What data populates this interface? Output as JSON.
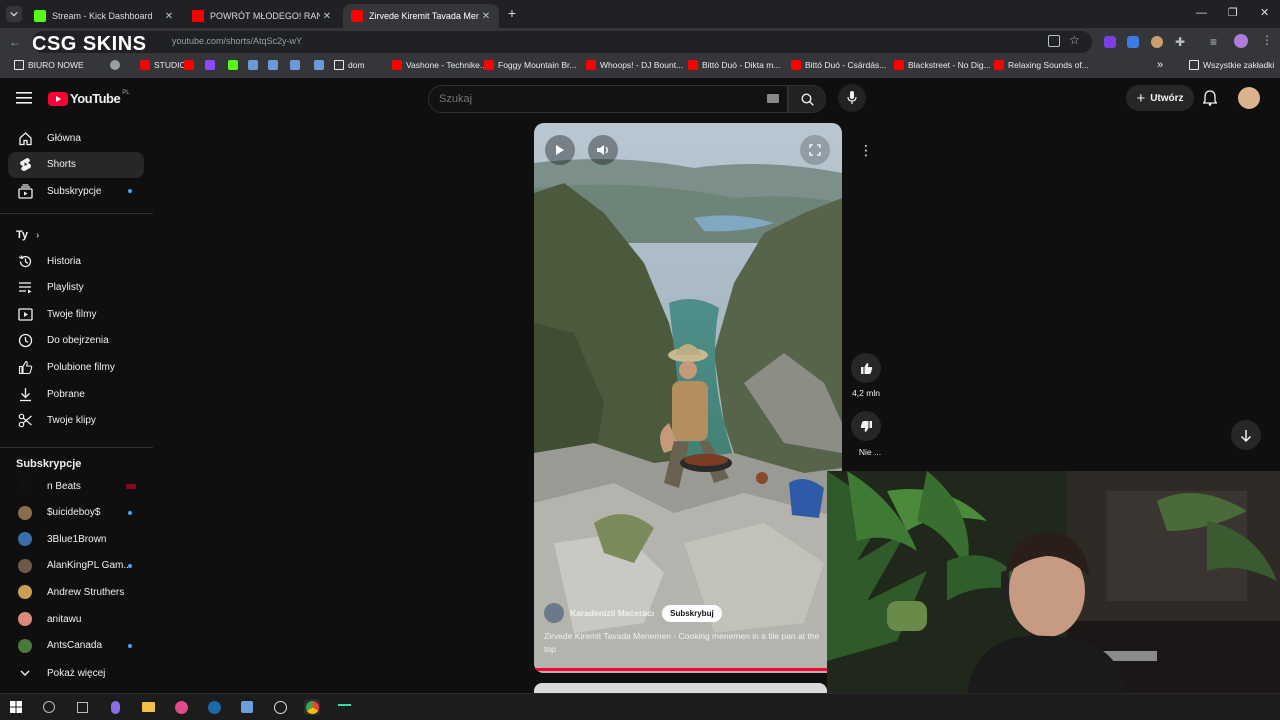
{
  "browser": {
    "tabs": [
      {
        "label": "Stream - Kick Dashboard",
        "color": "#53fc18"
      },
      {
        "label": "POWRÓT MŁODEGO! RANDKI I",
        "color": "#ff0000"
      },
      {
        "label": "Zirvede Kiremit Tavada Menem",
        "color": "#ff0000"
      }
    ],
    "new_tab": "+",
    "url": "youtube.com/shorts/AtqSc2y-wY",
    "overlay_logo": "CSG SKINS",
    "bookmarks": [
      {
        "label": "BIURO NOWE",
        "icon": "folder-icon"
      },
      {
        "label": "",
        "icon": "globe-icon"
      },
      {
        "label": "STUDIO",
        "icon": "youtube-icon"
      },
      {
        "label": "",
        "icon": "youtube-icon"
      },
      {
        "label": "",
        "icon": "twitch-icon"
      },
      {
        "label": "",
        "icon": "kick-icon"
      },
      {
        "label": "",
        "icon": "app-icon"
      },
      {
        "label": "",
        "icon": "app-icon"
      },
      {
        "label": "",
        "icon": "app-icon"
      },
      {
        "label": "",
        "icon": "app-icon"
      },
      {
        "label": "dom",
        "icon": "folder-icon"
      },
      {
        "label": "Vashone - Technike...",
        "icon": "youtube-icon"
      },
      {
        "label": "Foggy Mountain Br...",
        "icon": "youtube-icon"
      },
      {
        "label": "Whoops! - DJ Bount...",
        "icon": "youtube-icon"
      },
      {
        "label": "Bittó Duó - Dikta m...",
        "icon": "youtube-icon"
      },
      {
        "label": "Bittó Duó - Csárdás...",
        "icon": "youtube-icon"
      },
      {
        "label": "Blackstreet - No Dig...",
        "icon": "youtube-icon"
      },
      {
        "label": "Relaxing Sounds of...",
        "icon": "youtube-icon"
      }
    ],
    "more_bookmarks": "»",
    "all_bookmarks": "Wszystkie zakładki"
  },
  "youtube": {
    "logo_text": "YouTube",
    "region": "PL",
    "search_placeholder": "Szukaj",
    "create_label": "Utwórz",
    "sidebar": {
      "main": [
        {
          "label": "Główna",
          "icon": "home-icon"
        },
        {
          "label": "Shorts",
          "icon": "shorts-icon",
          "active": true
        },
        {
          "label": "Subskrypcje",
          "icon": "subscriptions-icon",
          "dot": true
        }
      ],
      "you_header": "Ty",
      "you": [
        {
          "label": "Historia",
          "icon": "history-icon"
        },
        {
          "label": "Playlisty",
          "icon": "playlist-icon"
        },
        {
          "label": "Twoje filmy",
          "icon": "video-icon"
        },
        {
          "label": "Do obejrzenia",
          "icon": "clock-icon"
        },
        {
          "label": "Polubione filmy",
          "icon": "like-icon"
        },
        {
          "label": "Pobrane",
          "icon": "download-icon"
        },
        {
          "label": "Twoje klipy",
          "icon": "scissors-icon"
        }
      ],
      "subs_header": "Subskrypcje",
      "subs": [
        {
          "label": "n Beats",
          "color": "#111111",
          "live": true
        },
        {
          "label": "$uicideboy$",
          "color": "#8a6d4a",
          "dot": true
        },
        {
          "label": "3Blue1Brown",
          "color": "#3b6ea8"
        },
        {
          "label": "AlanKingPL Gam...",
          "color": "#6b5a4a",
          "dot": true
        },
        {
          "label": "Andrew Struthers",
          "color": "#c9a050"
        },
        {
          "label": "anitawu",
          "color": "#d98a7a"
        },
        {
          "label": "AntsCanada",
          "color": "#4a7a3a",
          "dot": true
        }
      ],
      "show_more": "Pokaż więcej"
    },
    "short": {
      "channel": "Karadenizli Maceracı",
      "subscribe": "Subskrybuj",
      "title": "Zirvede Kiremit Tavada Menemen - Cooking menemen in a tile pan at the top",
      "likes": "4,2 mln",
      "dislike_label": "Nie ...",
      "progress": 0.97
    }
  },
  "colors": {
    "accent_red": "#ff0033",
    "accent_blue": "#3ea6ff"
  }
}
